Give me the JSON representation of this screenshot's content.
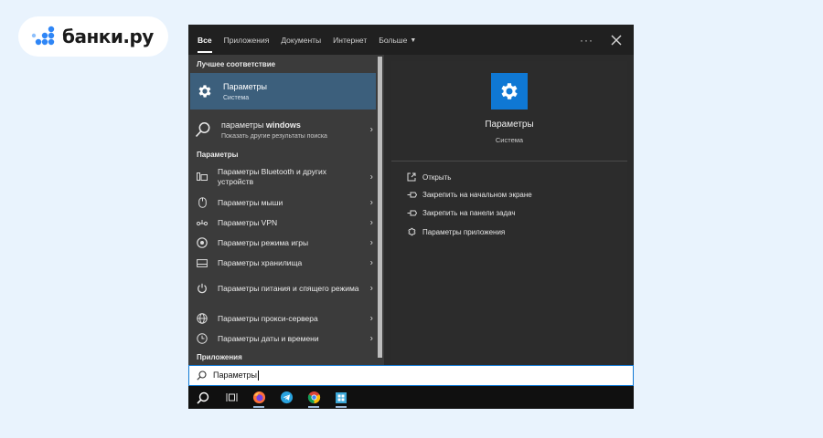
{
  "brand": {
    "logo_text": "банки.ру",
    "color": "#2f86f6"
  },
  "tabs": [
    {
      "label": "Все",
      "active": true
    },
    {
      "label": "Приложения"
    },
    {
      "label": "Документы"
    },
    {
      "label": "Интернет"
    },
    {
      "label": "Больше"
    }
  ],
  "left": {
    "best_match_header": "Лучшее соответствие",
    "best_match": {
      "title": "Параметры",
      "subtitle": "Система",
      "icon": "gear-icon"
    },
    "web": {
      "title_prefix": "параметры ",
      "title_bold": "windows",
      "subtitle": "Показать другие результаты поиска",
      "icon": "search-icon"
    },
    "settings_header": "Параметры",
    "settings_items": [
      {
        "label": "Параметры Bluetooth и других устройств",
        "icon": "devices-icon"
      },
      {
        "label": "Параметры мыши",
        "icon": "mouse-icon"
      },
      {
        "label": "Параметры VPN",
        "icon": "vpn-icon"
      },
      {
        "label": "Параметры режима игры",
        "icon": "game-icon"
      },
      {
        "label": "Параметры хранилища",
        "icon": "storage-icon"
      },
      {
        "label": "Параметры питания и спящего режима",
        "icon": "power-icon"
      },
      {
        "label": "Параметры прокси-сервера",
        "icon": "globe-icon"
      },
      {
        "label": "Параметры даты и времени",
        "icon": "clock-icon"
      }
    ],
    "apps_header": "Приложения"
  },
  "right": {
    "title": "Параметры",
    "subtitle": "Система",
    "actions": [
      {
        "label": "Открыть",
        "icon": "open-icon"
      },
      {
        "label": "Закрепить на начальном экране",
        "icon": "pin-icon"
      },
      {
        "label": "Закрепить на панели задач",
        "icon": "pin-icon"
      },
      {
        "label": "Параметры приложения",
        "icon": "gear-icon"
      }
    ]
  },
  "search": {
    "value": "Параметры"
  },
  "taskbar": [
    {
      "name": "search",
      "icon": "search-icon"
    },
    {
      "name": "task-view",
      "icon": "task-view-icon"
    },
    {
      "name": "firefox",
      "icon": "firefox-icon"
    },
    {
      "name": "telegram",
      "icon": "telegram-icon"
    },
    {
      "name": "chrome",
      "icon": "chrome-icon"
    },
    {
      "name": "store",
      "icon": "store-icon"
    }
  ],
  "colors": {
    "accent": "#0f78d4",
    "selection": "#3c5f7c"
  }
}
